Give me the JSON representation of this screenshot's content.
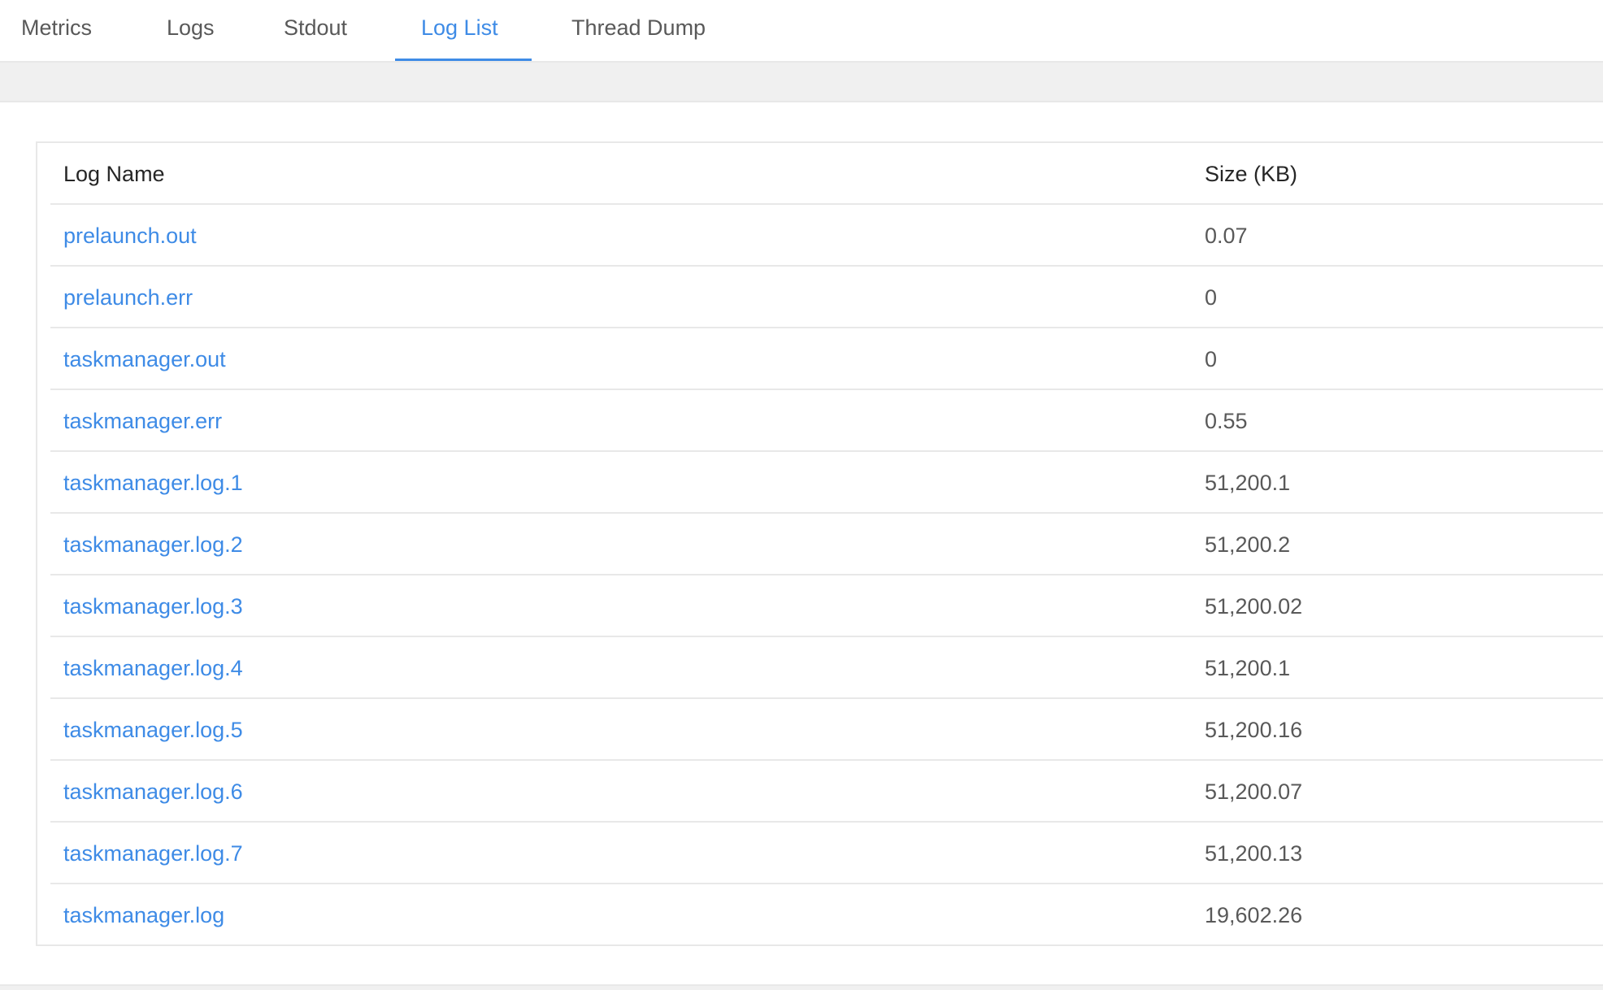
{
  "tabs": [
    {
      "label": "Metrics",
      "active": false
    },
    {
      "label": "Logs",
      "active": false
    },
    {
      "label": "Stdout",
      "active": false
    },
    {
      "label": "Log List",
      "active": true
    },
    {
      "label": "Thread Dump",
      "active": false
    }
  ],
  "colors": {
    "accent": "#3e8be6",
    "text": "#595959",
    "border": "#e8e8e8",
    "band": "#f0f0f0"
  },
  "table": {
    "columns": [
      "Log Name",
      "Size (KB)"
    ],
    "rows": [
      {
        "name": "prelaunch.out",
        "size": "0.07"
      },
      {
        "name": "prelaunch.err",
        "size": "0"
      },
      {
        "name": "taskmanager.out",
        "size": "0"
      },
      {
        "name": "taskmanager.err",
        "size": "0.55"
      },
      {
        "name": "taskmanager.log.1",
        "size": "51,200.1"
      },
      {
        "name": "taskmanager.log.2",
        "size": "51,200.2"
      },
      {
        "name": "taskmanager.log.3",
        "size": "51,200.02"
      },
      {
        "name": "taskmanager.log.4",
        "size": "51,200.1"
      },
      {
        "name": "taskmanager.log.5",
        "size": "51,200.16"
      },
      {
        "name": "taskmanager.log.6",
        "size": "51,200.07"
      },
      {
        "name": "taskmanager.log.7",
        "size": "51,200.13"
      },
      {
        "name": "taskmanager.log",
        "size": "19,602.26"
      }
    ]
  }
}
